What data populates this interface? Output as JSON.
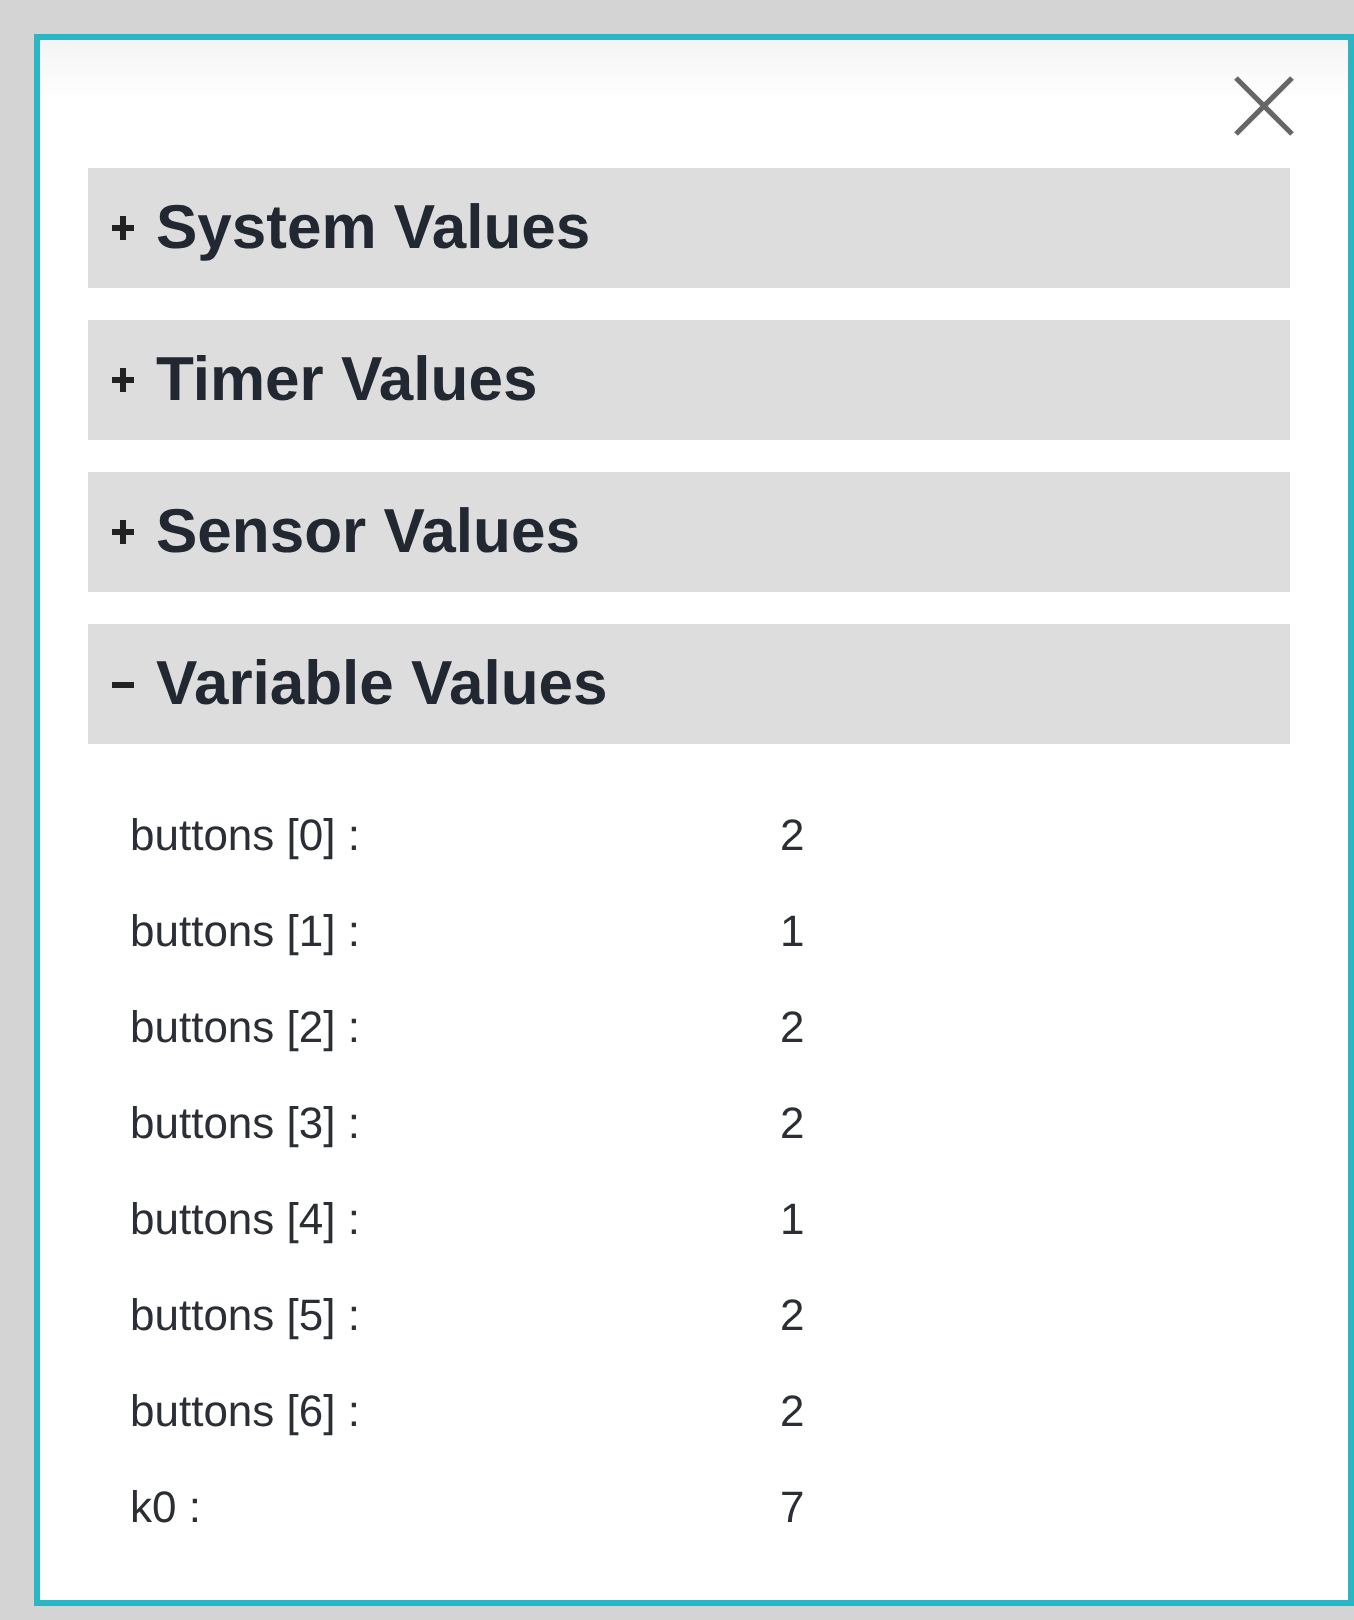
{
  "sections": [
    {
      "title": "System Values",
      "expanded": false
    },
    {
      "title": "Timer Values",
      "expanded": false
    },
    {
      "title": "Sensor Values",
      "expanded": false
    },
    {
      "title": "Variable Values",
      "expanded": true,
      "rows": [
        {
          "name": "buttons [0] :",
          "value": "2"
        },
        {
          "name": "buttons [1] :",
          "value": "1"
        },
        {
          "name": "buttons [2] :",
          "value": "2"
        },
        {
          "name": "buttons [3] :",
          "value": "2"
        },
        {
          "name": "buttons [4] :",
          "value": "1"
        },
        {
          "name": "buttons [5] :",
          "value": "2"
        },
        {
          "name": "buttons [6] :",
          "value": "2"
        },
        {
          "name": "k0 :",
          "value": "7"
        }
      ]
    }
  ]
}
